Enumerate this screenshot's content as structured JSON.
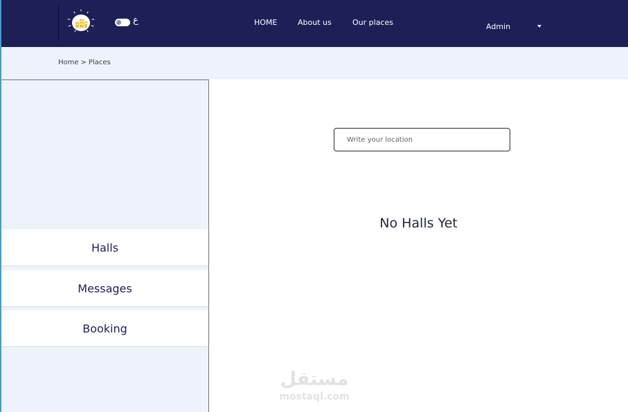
{
  "header": {
    "logo_icon": "lightbulb-building-logo-icon",
    "language_toggle_label": "ع",
    "nav": [
      {
        "label": "HOME"
      },
      {
        "label": "About us"
      },
      {
        "label": "Our places"
      }
    ],
    "user": {
      "name": "Admin",
      "dropdown_icon": "caret-down-icon"
    }
  },
  "breadcrumb": {
    "items": [
      {
        "label": "Home"
      },
      {
        "label": "Places"
      }
    ],
    "separator": ">"
  },
  "sidebar": {
    "items": [
      {
        "label": "Halls"
      },
      {
        "label": "Messages"
      },
      {
        "label": "Booking"
      }
    ]
  },
  "main": {
    "search": {
      "placeholder": "Write your location",
      "value": ""
    },
    "empty_state": "No Halls Yet"
  },
  "watermark": {
    "arabic": "مستقل",
    "latin": "mostaql.com"
  },
  "colors": {
    "header_bg": "#1d1f57",
    "band_bg": "#eef2fa",
    "accent_edge": "#3b9fd6",
    "logo_yellow": "#f2c230"
  }
}
